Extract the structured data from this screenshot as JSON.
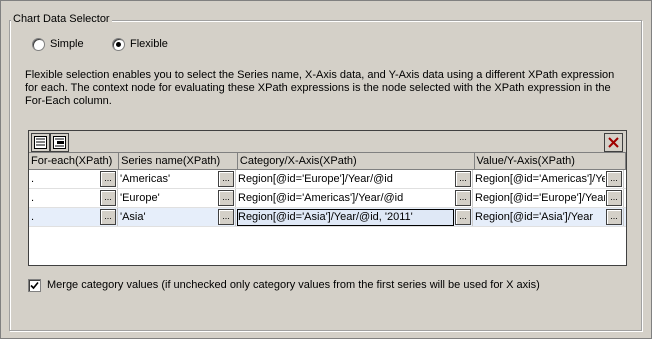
{
  "group_title": "Chart Data Selector",
  "mode": {
    "simple_label": "Simple",
    "flexible_label": "Flexible",
    "selected": "Flexible"
  },
  "description": "Flexible selection enables you to select the Series name, X-Axis data, and Y-Axis data using a different XPath expression for each. The context node for evaluating these XPath expressions is the node selected with the XPath expression in the For-Each column.",
  "table": {
    "columns": [
      "For-each(XPath)",
      "Series name(XPath)",
      "Category/X-Axis(XPath)",
      "Value/Y-Axis(XPath)"
    ],
    "ellipsis": "...",
    "rows": [
      {
        "foreach": ".",
        "series": "'Americas'",
        "category": "Region[@id='Europe']/Year/@id",
        "value": "Region[@id='Americas']/Year"
      },
      {
        "foreach": ".",
        "series": "'Europe'",
        "category": "Region[@id='Americas']/Year/@id",
        "value": "Region[@id='Europe']/Year"
      },
      {
        "foreach": ".",
        "series": "'Asia'",
        "category": "Region[@id='Asia']/Year/@id, '2011'",
        "value": "Region[@id='Asia']/Year"
      }
    ]
  },
  "merge_label": "Merge category values (if unchecked only category values from the first series will be used for X axis)",
  "merge_checked": true,
  "icons": {
    "append_row": "append-row-icon",
    "insert_row": "insert-row-icon",
    "delete_row": "delete-row-icon"
  },
  "colors": {
    "delete_icon": "#a00000",
    "selected_row": "#e6eefa"
  }
}
